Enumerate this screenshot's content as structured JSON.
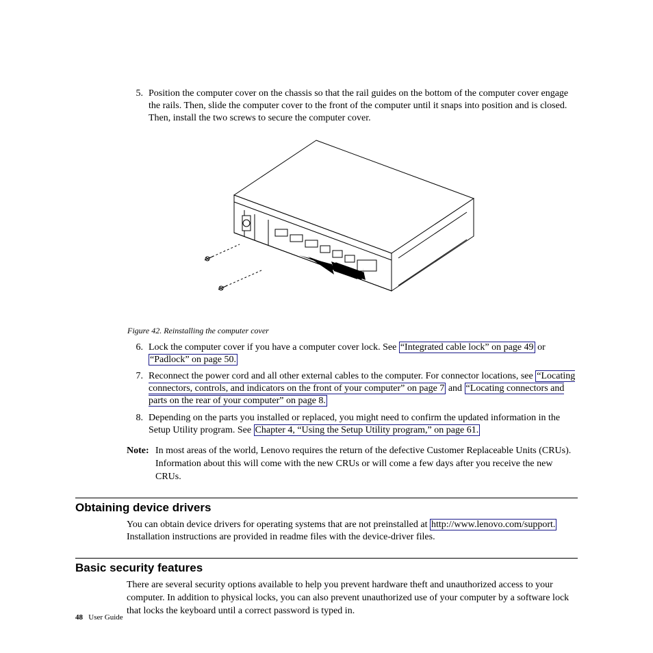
{
  "steps": {
    "s5": {
      "num": "5.",
      "text": "Position the computer cover on the chassis so that the rail guides on the bottom of the computer cover engage the rails. Then, slide the computer cover to the front of the computer until it snaps into position and is closed. Then, install the two screws to secure the computer cover."
    },
    "s6": {
      "num": "6.",
      "text_a": "Lock the computer cover if you have a computer cover lock. See ",
      "link1": "“Integrated cable lock” on page 49",
      "text_b": " or ",
      "link2": "“Padlock” on page 50.",
      "text_c": ""
    },
    "s7": {
      "num": "7.",
      "text_a": "Reconnect the power cord and all other external cables to the computer. For connector locations, see ",
      "link1": "“Locating connectors, controls, and indicators on the front of your computer” on page 7",
      "text_b": " and ",
      "link2": "“Locating connectors and parts on the rear of your computer” on page 8.",
      "text_c": ""
    },
    "s8": {
      "num": "8.",
      "text_a": "Depending on the parts you installed or replaced, you might need to confirm the updated information in the Setup Utility program. See ",
      "link1": "Chapter 4, “Using the Setup Utility program,” on page 61.",
      "text_b": ""
    }
  },
  "figure_caption": "Figure 42. Reinstalling the computer cover",
  "note": {
    "label": "Note:",
    "text": "In most areas of the world, Lenovo requires the return of the defective Customer Replaceable Units (CRUs). Information about this will come with the new CRUs or will come a few days after you receive the new CRUs."
  },
  "sections": {
    "drivers": {
      "heading": "Obtaining device drivers",
      "text_a": "You can obtain device drivers for operating systems that are not preinstalled at ",
      "link": "http://www.lenovo.com/support.",
      "text_b": " Installation instructions are provided in readme files with the device-driver files."
    },
    "security": {
      "heading": "Basic security features",
      "text": "There are several security options available to help you prevent hardware theft and unauthorized access to your computer. In addition to physical locks, you can also prevent unauthorized use of your computer by a software lock that locks the keyboard until a correct password is typed in."
    }
  },
  "footer": {
    "page": "48",
    "label": "User Guide"
  }
}
